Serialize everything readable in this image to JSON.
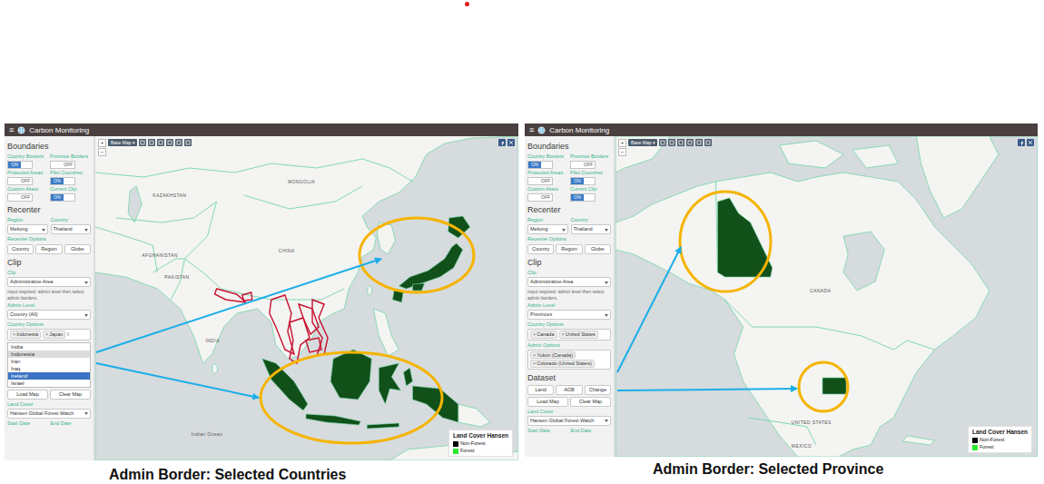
{
  "screens": [
    {
      "caption": "Admin Border: Selected Countries",
      "app": {
        "menu_icon": "≡",
        "title": "Carbon Monitoring"
      },
      "sidebar": [
        {
          "kind": "heading",
          "text": "Boundaries"
        },
        {
          "kind": "toggles",
          "items": [
            {
              "label": "Country Borders",
              "on": true,
              "state": "ON"
            },
            {
              "label": "Province Borders",
              "on": false,
              "state": "OFF"
            },
            {
              "label": "Protected Areas",
              "on": false,
              "state": "OFF"
            },
            {
              "label": "Pilot Countries",
              "on": true,
              "state": "ON"
            },
            {
              "label": "Custom Asset",
              "on": false,
              "state": "OFF"
            },
            {
              "label": "Current Clip",
              "on": true,
              "state": "ON"
            }
          ]
        },
        {
          "kind": "heading",
          "text": "Recenter"
        },
        {
          "kind": "selects",
          "items": [
            {
              "label": "Region",
              "value": "Mekong"
            },
            {
              "label": "Country",
              "value": "Thailand"
            }
          ]
        },
        {
          "kind": "label",
          "text": "Recenter Options"
        },
        {
          "kind": "buttons",
          "items": [
            "Country",
            "Region",
            "Globe"
          ]
        },
        {
          "kind": "heading",
          "text": "Clip"
        },
        {
          "kind": "select",
          "label": "Clip",
          "value": "Administrative Area"
        },
        {
          "kind": "note",
          "text": "Input required: admin level then select admin borders."
        },
        {
          "kind": "select",
          "label": "Admin Level",
          "value": "Country (All)"
        },
        {
          "kind": "tags",
          "label": "Country Options",
          "remove": "×",
          "tags": [
            "Indonesia",
            "Japan"
          ],
          "input": "I"
        },
        {
          "kind": "dropdown",
          "options": [
            {
              "label": "India",
              "selected": false,
              "chosen": false
            },
            {
              "label": "Indonesia",
              "selected": false,
              "chosen": true
            },
            {
              "label": "Iran",
              "selected": false,
              "chosen": false
            },
            {
              "label": "Iraq",
              "selected": false,
              "chosen": false
            },
            {
              "label": "Ireland",
              "selected": true,
              "chosen": false
            },
            {
              "label": "Israel",
              "selected": false,
              "chosen": false
            }
          ]
        },
        {
          "kind": "buttons",
          "items": [
            "Load Map",
            "Clear Map"
          ]
        },
        {
          "kind": "select",
          "label": "Land Cover",
          "value": "Hansen Global Forest Watch"
        },
        {
          "kind": "dates",
          "items": [
            "Start Date",
            "End Date"
          ]
        }
      ],
      "map": {
        "base_map": "Base Map ▾",
        "zoom": [
          "+",
          "−"
        ],
        "labels": [
          "KAZAKHSTAN",
          "MONGOLIA",
          "CHINA",
          "AFGHANISTAN",
          "PAKISTAN",
          "INDIA",
          "Indian Ocean"
        ],
        "legend": {
          "title": "Land Cover Hansen",
          "items": [
            {
              "label": "Non-Forest",
              "color": "#000000"
            },
            {
              "label": "Forest",
              "color": "#2ee82e"
            }
          ]
        }
      }
    },
    {
      "caption": "Admin Border: Selected Province",
      "app": {
        "menu_icon": "≡",
        "title": "Carbon Monitoring"
      },
      "sidebar": [
        {
          "kind": "heading",
          "text": "Boundaries"
        },
        {
          "kind": "toggles",
          "items": [
            {
              "label": "Country Borders",
              "on": true,
              "state": "ON"
            },
            {
              "label": "Province Borders",
              "on": false,
              "state": "OFF"
            },
            {
              "label": "Protected Areas",
              "on": false,
              "state": "OFF"
            },
            {
              "label": "Pilot Countries",
              "on": true,
              "state": "ON"
            },
            {
              "label": "Custom Asset",
              "on": false,
              "state": "OFF"
            },
            {
              "label": "Current Clip",
              "on": true,
              "state": "ON"
            }
          ]
        },
        {
          "kind": "heading",
          "text": "Recenter"
        },
        {
          "kind": "selects",
          "items": [
            {
              "label": "Region",
              "value": "Mekong"
            },
            {
              "label": "Country",
              "value": "Thailand"
            }
          ]
        },
        {
          "kind": "label",
          "text": "Recenter Options"
        },
        {
          "kind": "buttons",
          "items": [
            "Country",
            "Region",
            "Globe"
          ]
        },
        {
          "kind": "heading",
          "text": "Clip"
        },
        {
          "kind": "select",
          "label": "Clip",
          "value": "Administrative Area"
        },
        {
          "kind": "note",
          "text": "Input required: admin level then select admin borders."
        },
        {
          "kind": "select",
          "label": "Admin Level",
          "value": "Provinces"
        },
        {
          "kind": "tags",
          "label": "Country Options",
          "remove": "×",
          "tags": [
            "Canada",
            "United States"
          ]
        },
        {
          "kind": "tags",
          "label": "Admin Options",
          "remove": "×",
          "tags": [
            "Yukon (Canada)",
            "Colorado (United States)"
          ]
        },
        {
          "kind": "heading",
          "text": "Dataset"
        },
        {
          "kind": "buttons",
          "items": [
            "Land",
            "AGB",
            "Change"
          ]
        },
        {
          "kind": "buttons",
          "items": [
            "Load Map",
            "Clear Map"
          ]
        },
        {
          "kind": "select",
          "label": "Land Cover",
          "value": "Hansen Global Forest Watch"
        },
        {
          "kind": "dates",
          "items": [
            "Start Date",
            "End Date"
          ]
        }
      ],
      "map": {
        "base_map": "Base Map ▾",
        "zoom": [
          "+",
          "−"
        ],
        "labels": [
          "CANADA",
          "UNITED STATES",
          "MEXICO"
        ],
        "legend": {
          "title": "Land Cover Hansen",
          "items": [
            {
              "label": "Non-Forest",
              "color": "#000000"
            },
            {
              "label": "Forest",
              "color": "#2ee82e"
            }
          ]
        }
      }
    }
  ]
}
